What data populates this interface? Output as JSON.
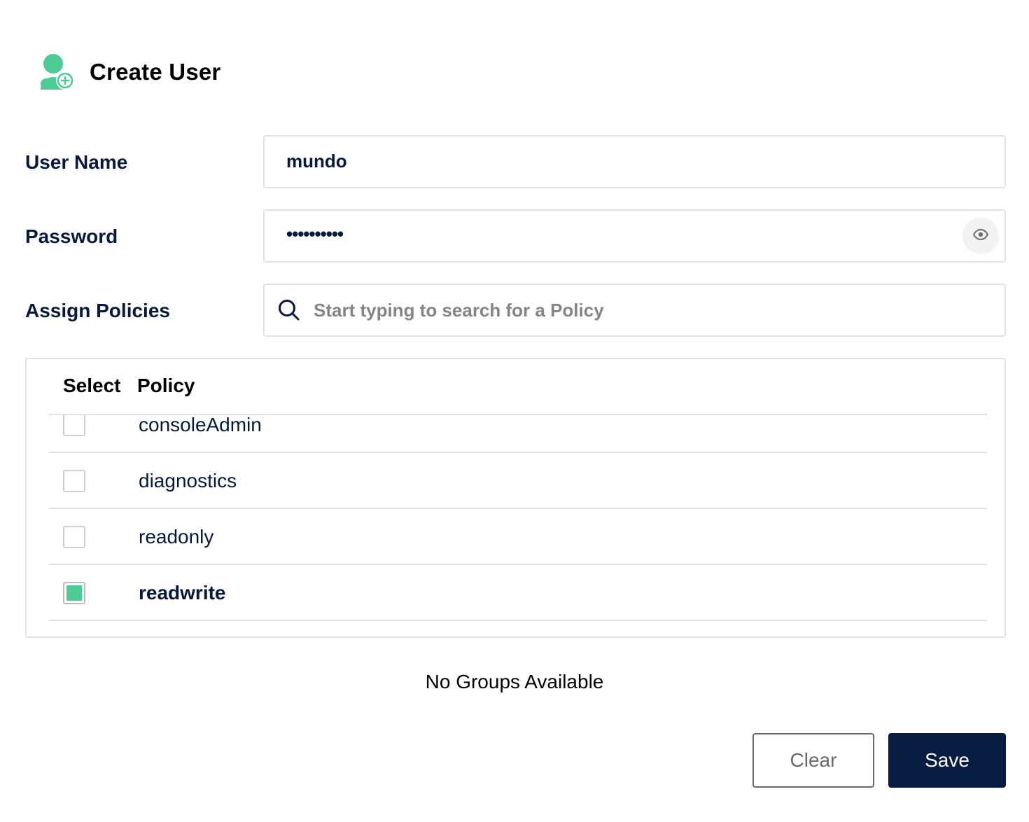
{
  "header": {
    "title": "Create User",
    "icon": "user-add-icon",
    "accent_color": "#4ccb92"
  },
  "form": {
    "username": {
      "label": "User Name",
      "value": "mundo"
    },
    "password": {
      "label": "Password",
      "masked_value": "••••••••••",
      "toggle_icon": "eye-icon"
    },
    "policies": {
      "label": "Assign Policies",
      "placeholder": "Start typing to search for a Policy",
      "icon": "search-icon"
    }
  },
  "policy_table": {
    "columns": [
      "Select",
      "Policy"
    ],
    "rows": [
      {
        "name": "consoleAdmin",
        "checked": false
      },
      {
        "name": "diagnostics",
        "checked": false
      },
      {
        "name": "readonly",
        "checked": false
      },
      {
        "name": "readwrite",
        "checked": true
      }
    ]
  },
  "groups": {
    "empty_message": "No Groups Available"
  },
  "actions": {
    "clear_label": "Clear",
    "save_label": "Save",
    "save_color": "#081c42"
  }
}
